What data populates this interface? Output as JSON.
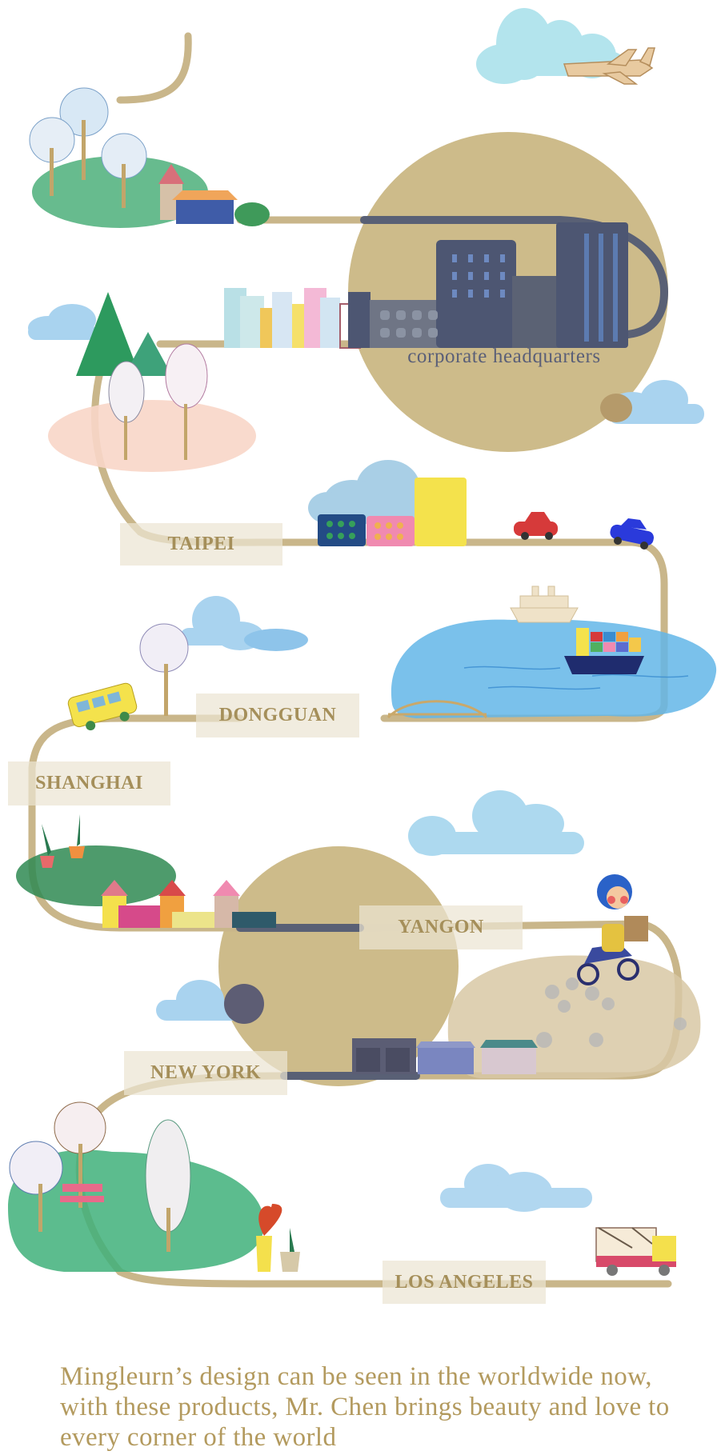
{
  "map": {
    "hq_caption": "corporate headquarters",
    "cities": [
      "TAIPEI",
      "DONGGUAN",
      "SHANGHAI",
      "YANGON",
      "NEW YORK",
      "LOS ANGELES"
    ]
  },
  "closing_text": "Mingleurn’s design can be seen in the worldwide now, with these products, Mr. Chen brings beauty and love to every corner of the world",
  "colors": {
    "road": "#c9b68a",
    "label_text": "#a58f5a",
    "label_bg": "#ece4d2",
    "building_navy": "#4d5672",
    "circle": "#cdbb8a",
    "caption_text": "#5a5f78",
    "body_text": "#b39a5e"
  }
}
